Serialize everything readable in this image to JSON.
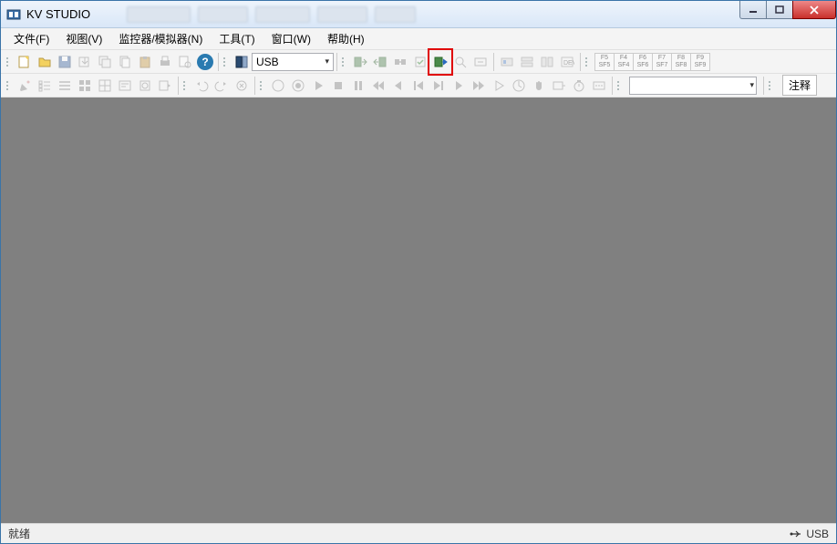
{
  "title": "KV STUDIO",
  "menus": {
    "file": "文件(F)",
    "view": "视图(V)",
    "monitor": "监控器/模拟器(N)",
    "tool": "工具(T)",
    "window": "窗口(W)",
    "help": "帮助(H)"
  },
  "connection": {
    "selected": "USB"
  },
  "fkeys": [
    {
      "t": "F5",
      "b": "SF5"
    },
    {
      "t": "F4",
      "b": "SF4"
    },
    {
      "t": "F6",
      "b": "SF6"
    },
    {
      "t": "F7",
      "b": "SF7"
    },
    {
      "t": "F8",
      "b": "SF8"
    },
    {
      "t": "F9",
      "b": "SF9"
    }
  ],
  "annotation_dropdown": "注释",
  "status": {
    "ready": "就绪",
    "conn": "USB"
  },
  "icons": {
    "help": "?"
  }
}
